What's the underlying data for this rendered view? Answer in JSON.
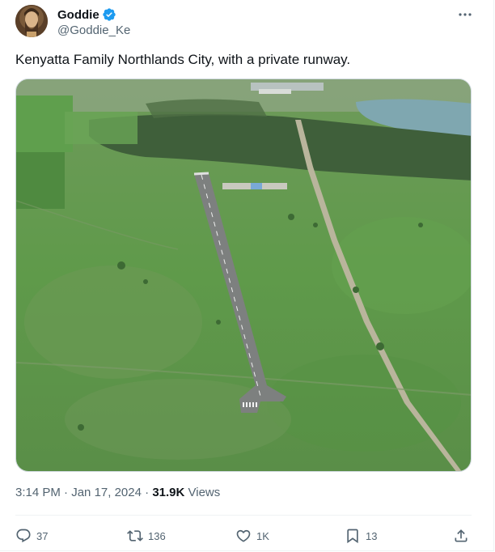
{
  "author": {
    "display_name": "Goddie",
    "handle": "@Goddie_Ke",
    "verified": true
  },
  "tweet": {
    "text": "Kenyatta Family Northlands City, with a private runway.",
    "media_description_icon": "aerial-photo",
    "time": "3:14 PM",
    "separator": " · ",
    "date": "Jan 17, 2024",
    "separator2": " · ",
    "views_count": "31.9K",
    "views_label": " Views"
  },
  "actions": {
    "replies": "37",
    "reposts": "136",
    "likes": "1K",
    "bookmarks": "13"
  },
  "colors": {
    "accent": "#1d9bf0",
    "text_primary": "#0f1419",
    "text_secondary": "#536471",
    "border": "#cfd9de"
  }
}
